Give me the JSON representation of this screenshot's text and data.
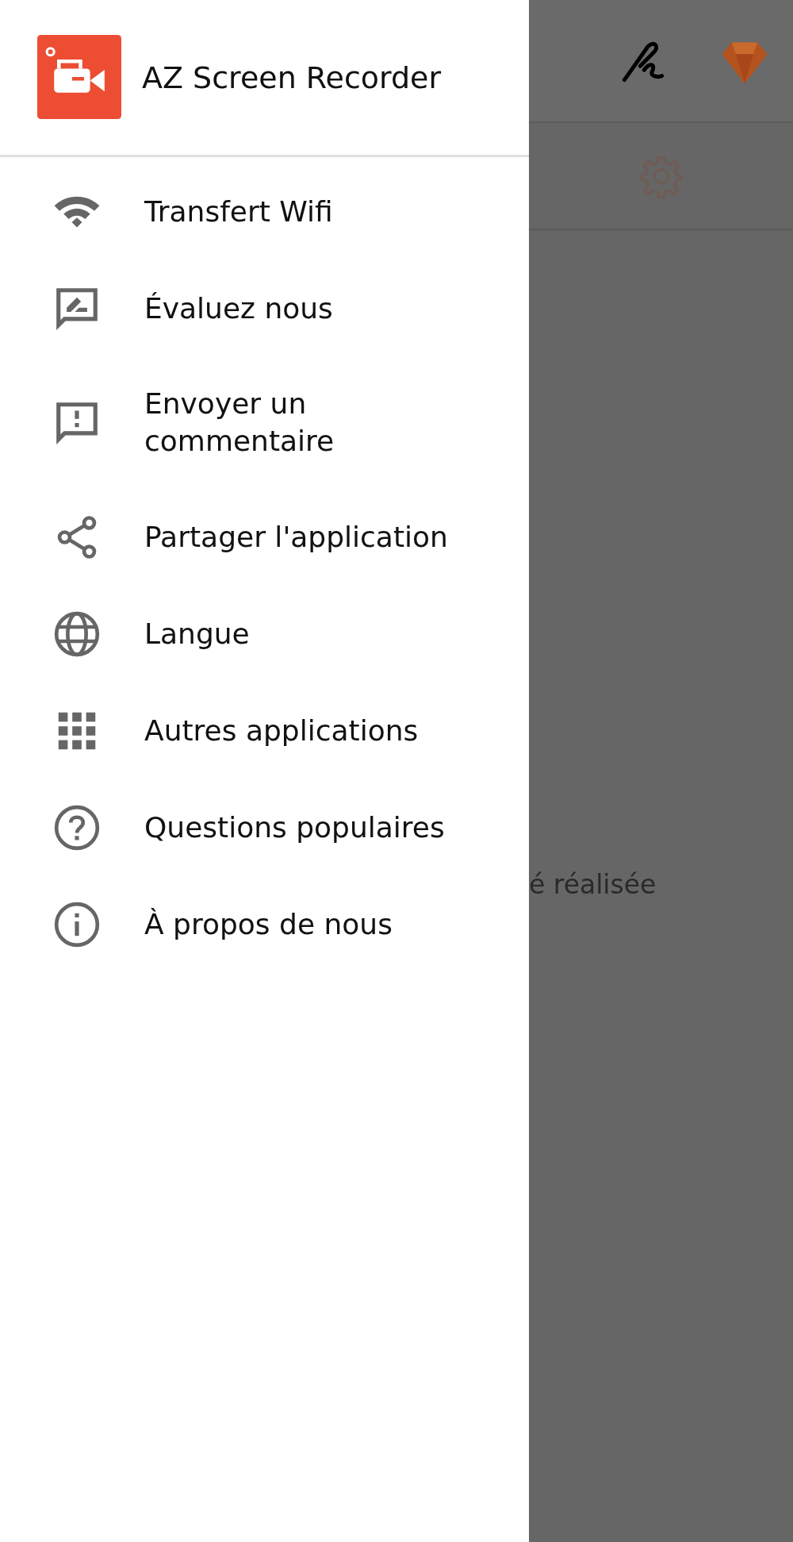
{
  "drawer": {
    "title": "AZ Screen Recorder",
    "items": [
      {
        "label": "Transfert Wifi",
        "kind": "wifi"
      },
      {
        "label": "Évaluez nous",
        "kind": "rate"
      },
      {
        "label": "Envoyer un commentaire",
        "kind": "feedback"
      },
      {
        "label": "Partager l'application",
        "kind": "share"
      },
      {
        "label": "Langue",
        "kind": "globe"
      },
      {
        "label": "Autres applications",
        "kind": "apps"
      },
      {
        "label": "Questions populaires",
        "kind": "help"
      },
      {
        "label": "À propos de nous",
        "kind": "info"
      }
    ]
  },
  "background": {
    "message": "é réalisée"
  }
}
